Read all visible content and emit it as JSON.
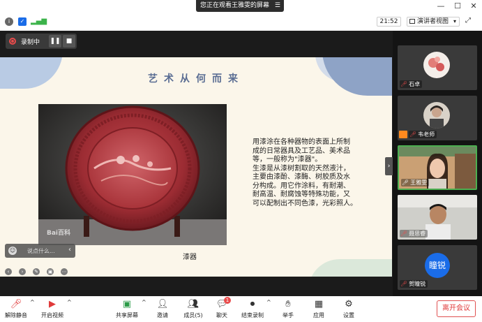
{
  "share_banner": {
    "text": "您正在观看王雅雯的屏幕",
    "menu_icon": "menu-icon"
  },
  "window_controls": {
    "minimize": "—",
    "maximize": "☐",
    "close": "✕"
  },
  "status": {
    "time": "21:52",
    "view_mode": "演讲者视图"
  },
  "recording": {
    "label": "录制中",
    "pause_icon": "pause-icon",
    "stop_icon": "stop-icon"
  },
  "slide": {
    "title": "艺术从何而来",
    "caption": "漆器",
    "watermark": "Bai百科",
    "body_lines": [
      "用漆涂在各种器物的表面上所制",
      "成的日常器具及工艺品、美术品",
      "等，一般称为\"漆器\"。",
      "生漆是从漆树割取的天然液汁，",
      "主要由漆酚、漆酶、树胶质及水",
      "分构成。用它作涂料，有耐潮、",
      "耐高温、耐腐蚀等特殊功能，又",
      "可以配制出不同色漆，光彩照人。"
    ]
  },
  "comment": {
    "placeholder": "说点什么..."
  },
  "participants": [
    {
      "name": "石卓",
      "type": "avatar-floral",
      "muted": true
    },
    {
      "name": "韦老师",
      "type": "avatar-photo",
      "muted": true,
      "host": true
    },
    {
      "name": "王雅雯",
      "type": "video-girl",
      "muted": false,
      "active": true
    },
    {
      "name": "聂思睿",
      "type": "video-boy",
      "muted": true
    },
    {
      "name": "贺瞳锐",
      "type": "initials",
      "initials": "瞳锐",
      "muted": true
    }
  ],
  "toolbar": {
    "unmute": "解除静音",
    "start_video": "开启视频",
    "share_screen": "共享屏幕",
    "invite": "邀请",
    "members": "成员(5)",
    "chat": "聊天",
    "chat_badge": "1",
    "end_record": "结束录制",
    "raise_hand": "举手",
    "apps": "应用",
    "settings": "设置",
    "leave": "离开会议"
  },
  "colors": {
    "accent": "#1a6ce8",
    "leave": "#e03a3a",
    "title": "#5a6d93",
    "active_border": "#4caf50"
  }
}
